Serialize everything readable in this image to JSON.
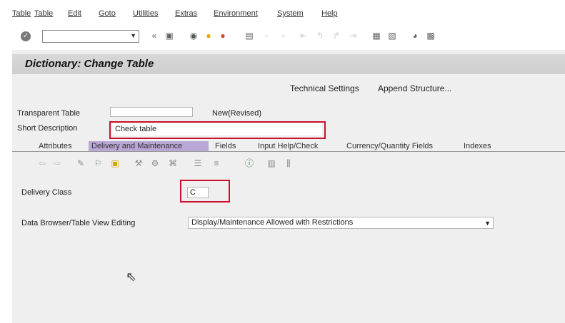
{
  "menu": {
    "items": [
      "Table",
      "Edit",
      "Goto",
      "Utilities",
      "Extras",
      "Environment",
      "System",
      "Help"
    ]
  },
  "toolbar": {
    "command_value": "",
    "icons": [
      "enter-icon",
      "save-icon",
      "back-icon",
      "exit-icon",
      "cancel-icon",
      "print-icon",
      "find-icon",
      "find-next-icon",
      "first-page-icon",
      "previous-page-icon",
      "next-page-icon",
      "last-page-icon",
      "create-session-icon",
      "shortcut-icon",
      "help-icon",
      "customize-layout-icon"
    ]
  },
  "screen": {
    "title": "Dictionary: Change Table"
  },
  "app_toolbar": {
    "technical_settings": "Technical Settings",
    "append_structure": "Append Structure..."
  },
  "header": {
    "transparent_table_label": "Transparent Table",
    "transparent_table_value": "",
    "status": "New(Revised)",
    "short_description_label": "Short Description",
    "short_description_value": "Check table"
  },
  "tabs": [
    {
      "label": "Attributes",
      "active": false
    },
    {
      "label": "Delivery and Maintenance",
      "active": true
    },
    {
      "label": "Fields",
      "active": false
    },
    {
      "label": "Input Help/Check",
      "active": false
    },
    {
      "label": "Currency/Quantity Fields",
      "active": false
    },
    {
      "label": "Indexes",
      "active": false
    }
  ],
  "delivery": {
    "delivery_class_label": "Delivery Class",
    "delivery_class_value": "C",
    "browser_label": "Data Browser/Table View Editing",
    "browser_value": "Display/Maintenance Allowed with Restrictions"
  },
  "colors": {
    "highlight": "#c8102e",
    "active_tab": "#b9a7d6"
  }
}
